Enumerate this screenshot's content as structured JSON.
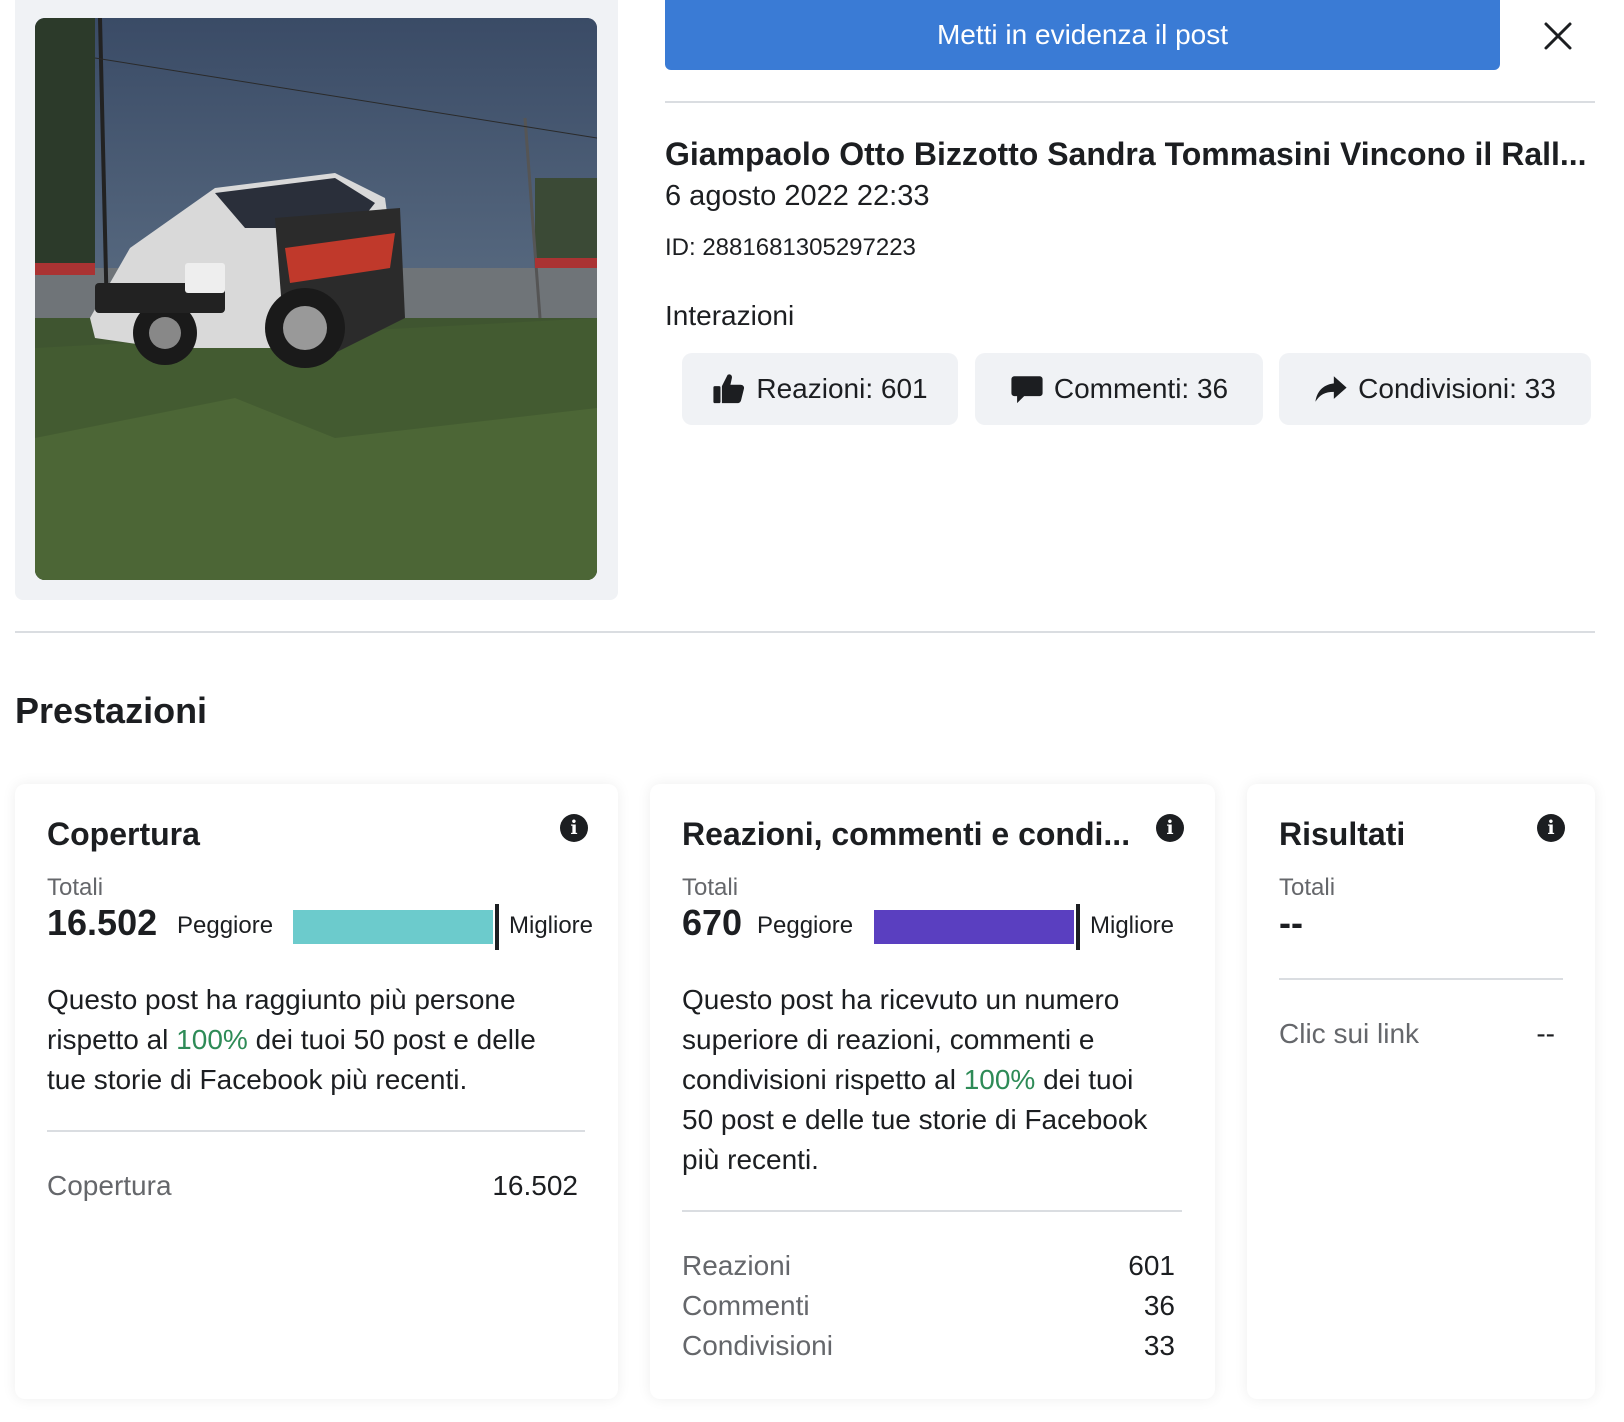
{
  "header": {
    "boost_label": "Metti in evidenza il post"
  },
  "post": {
    "title": "Giampaolo Otto Bizzotto Sandra Tommasini Vincono il Rall...",
    "date": "6 agosto 2022 22:33",
    "id_text": "ID: 2881681305297223",
    "interactions_label": "Interazioni",
    "chips": {
      "reactions": "Reazioni: 601",
      "comments": "Commenti: 36",
      "shares": "Condivisioni: 33"
    }
  },
  "performance": {
    "title": "Prestazioni",
    "reach": {
      "title": "Copertura",
      "totals_label": "Totali",
      "total": "16.502",
      "worse_label": "Peggiore",
      "better_label": "Migliore",
      "bar_color": "#6ccbcc",
      "bar_fraction": 1.0,
      "desc_1": "Questo post ha raggiunto più persone",
      "desc_2a": "rispetto al ",
      "desc_pct": "100%",
      "desc_2b": " dei tuoi 50 post e delle",
      "desc_3": "tue storie di Facebook più recenti.",
      "rows": [
        {
          "label": "Copertura",
          "value": "16.502"
        }
      ]
    },
    "engagement": {
      "title": "Reazioni, commenti e condi...",
      "totals_label": "Totali",
      "total": "670",
      "worse_label": "Peggiore",
      "better_label": "Migliore",
      "bar_color": "#5a3fc0",
      "bar_fraction": 1.0,
      "desc_1": "Questo post ha ricevuto un numero",
      "desc_2": "superiore di reazioni, commenti e",
      "desc_3a": "condivisioni rispetto al ",
      "desc_pct": "100%",
      "desc_3b": " dei tuoi",
      "desc_4": "50 post e delle tue storie di Facebook",
      "desc_5": "più recenti.",
      "rows": [
        {
          "label": "Reazioni",
          "value": "601"
        },
        {
          "label": "Commenti",
          "value": "36"
        },
        {
          "label": "Condivisioni",
          "value": "33"
        }
      ]
    },
    "results": {
      "title": "Risultati",
      "totals_label": "Totali",
      "total": "--",
      "rows": [
        {
          "label": "Clic sui link",
          "value": "--"
        }
      ]
    }
  },
  "colors": {
    "accent": "#3a7bd5",
    "highlight_green": "#2e8b57"
  },
  "icons": {
    "close": "close-icon",
    "like": "thumbs-up-icon",
    "comment": "comment-bubble-icon",
    "share": "share-arrow-icon",
    "info": "info-icon"
  }
}
